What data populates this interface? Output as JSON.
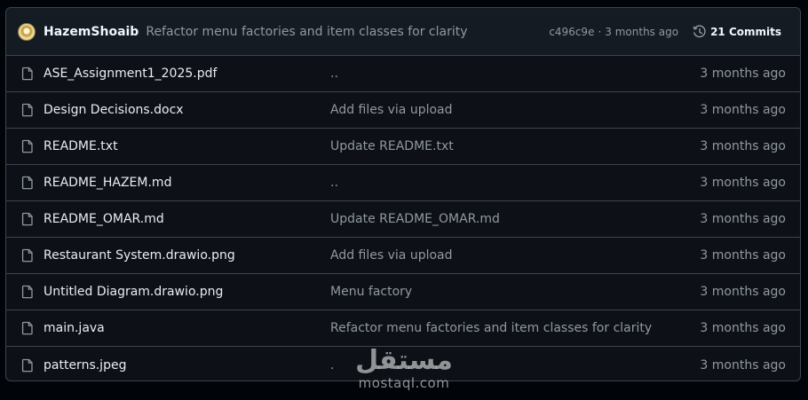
{
  "latest_commit": {
    "author": "HazemShoaib",
    "message": "Refactor menu factories and item classes for clarity",
    "hash": "c496c9e",
    "separator": "·",
    "time": "3 months ago",
    "commits_label": "21 Commits",
    "history_icon": "history-clock-icon",
    "avatar_icon": "user-avatar"
  },
  "files": [
    {
      "name": "ASE_Assignment1_2025.pdf",
      "commit": "..",
      "date": "3 months ago",
      "icon": "file-icon"
    },
    {
      "name": "Design Decisions.docx",
      "commit": "Add files via upload",
      "date": "3 months ago",
      "icon": "file-icon"
    },
    {
      "name": "README.txt",
      "commit": "Update README.txt",
      "date": "3 months ago",
      "icon": "file-icon"
    },
    {
      "name": "README_HAZEM.md",
      "commit": "..",
      "date": "3 months ago",
      "icon": "file-icon"
    },
    {
      "name": "README_OMAR.md",
      "commit": "Update README_OMAR.md",
      "date": "3 months ago",
      "icon": "file-icon"
    },
    {
      "name": "Restaurant System.drawio.png",
      "commit": "Add files via upload",
      "date": "3 months ago",
      "icon": "file-icon"
    },
    {
      "name": "Untitled Diagram.drawio.png",
      "commit": "Menu factory",
      "date": "3 months ago",
      "icon": "file-icon"
    },
    {
      "name": "main.java",
      "commit": "Refactor menu factories and item classes for clarity",
      "date": "3 months ago",
      "icon": "file-icon"
    },
    {
      "name": "patterns.jpeg",
      "commit": ".",
      "date": "3 months ago",
      "icon": "file-icon"
    }
  ],
  "watermark": {
    "arabic": "مستقل",
    "latin": "mostaql.com"
  },
  "colors": {
    "page_background": "#010409",
    "box_background": "#0d1117",
    "header_background": "#151b23",
    "border": "#3d444d",
    "text_primary": "#e6edf3",
    "text_muted": "#9198a1"
  }
}
